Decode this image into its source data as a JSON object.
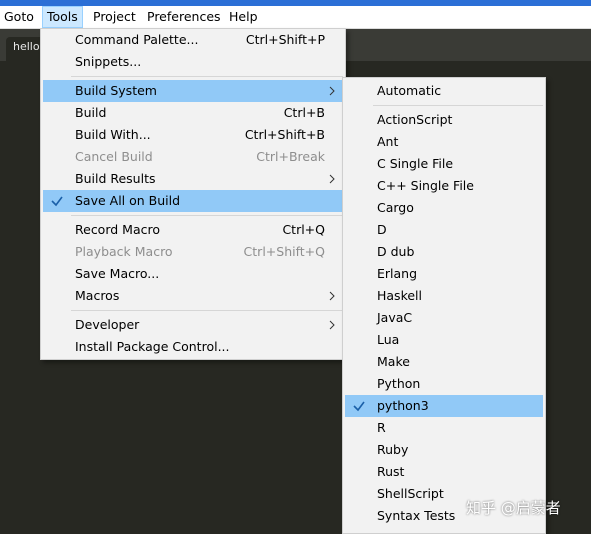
{
  "menubar": {
    "goto": "Goto",
    "tools": "Tools",
    "project": "Project",
    "preferences": "Preferences",
    "help": "Help"
  },
  "editor": {
    "tab_label": "hello"
  },
  "tools_menu": {
    "command_palette": {
      "label": "Command Palette...",
      "shortcut": "Ctrl+Shift+P"
    },
    "snippets": {
      "label": "Snippets..."
    },
    "build_system": {
      "label": "Build System"
    },
    "build": {
      "label": "Build",
      "shortcut": "Ctrl+B"
    },
    "build_with": {
      "label": "Build With...",
      "shortcut": "Ctrl+Shift+B"
    },
    "cancel_build": {
      "label": "Cancel Build",
      "shortcut": "Ctrl+Break"
    },
    "build_results": {
      "label": "Build Results"
    },
    "save_all_on_build": {
      "label": "Save All on Build"
    },
    "record_macro": {
      "label": "Record Macro",
      "shortcut": "Ctrl+Q"
    },
    "playback_macro": {
      "label": "Playback Macro",
      "shortcut": "Ctrl+Shift+Q"
    },
    "save_macro": {
      "label": "Save Macro..."
    },
    "macros": {
      "label": "Macros"
    },
    "developer": {
      "label": "Developer"
    },
    "install_package_control": {
      "label": "Install Package Control..."
    }
  },
  "build_system_menu": {
    "items": [
      "Automatic",
      "ActionScript",
      "Ant",
      "C Single File",
      "C++ Single File",
      "Cargo",
      "D",
      "D dub",
      "Erlang",
      "Haskell",
      "JavaC",
      "Lua",
      "Make",
      "Python",
      "python3",
      "R",
      "Ruby",
      "Rust",
      "ShellScript",
      "Syntax Tests"
    ],
    "selected": "python3"
  },
  "watermark": {
    "text": "知乎 @启蒙者"
  },
  "colors": {
    "highlight": "#91c9f7",
    "menu_bg": "#f2f2f2",
    "editor_bg": "#272822",
    "check": "#1a5fa8"
  }
}
